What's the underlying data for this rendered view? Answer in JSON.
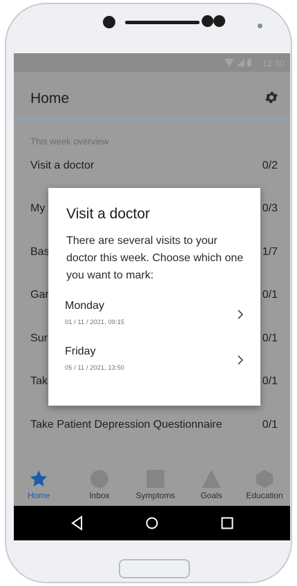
{
  "statusbar": {
    "time": "12:30",
    "icons": [
      "wifi-icon",
      "signal-icon",
      "battery-icon"
    ]
  },
  "appbar": {
    "title": "Home",
    "settings_icon": "gear-icon"
  },
  "overview": {
    "section_label": "This week overview",
    "rows": [
      {
        "label": "Visit a doctor",
        "count": "0/2"
      },
      {
        "label": "My",
        "count": "0/3"
      },
      {
        "label": "Bas",
        "count": "1/7"
      },
      {
        "label": "Gar",
        "count": "0/1"
      },
      {
        "label": "Sur",
        "count": "0/1"
      },
      {
        "label": "Tak",
        "count": "0/1"
      },
      {
        "label": "Take Patient Depression Questionnaire",
        "count": "0/1"
      }
    ]
  },
  "dialog": {
    "title": "Visit a doctor",
    "message": "There are several visits to your doctor this week. Choose which one you want to mark:",
    "choices": [
      {
        "day": "Monday",
        "datetime": "01 / 11 / 2021, 09:15"
      },
      {
        "day": "Friday",
        "datetime": "05 / 11 / 2021, 13:50"
      }
    ]
  },
  "bottom_nav": {
    "items": [
      {
        "label": "Home",
        "icon": "star-icon",
        "active": true
      },
      {
        "label": "Inbox",
        "icon": "circle-icon",
        "active": false
      },
      {
        "label": "Symptoms",
        "icon": "square-icon",
        "active": false
      },
      {
        "label": "Goals",
        "icon": "triangle-icon",
        "active": false
      },
      {
        "label": "Education",
        "icon": "hexagon-icon",
        "active": false
      }
    ]
  },
  "system_nav": [
    "back-icon",
    "home-icon",
    "recents-icon"
  ],
  "colors": {
    "accent": "#1a5ea8",
    "scrim": "#9c9c9c",
    "dialog_bg": "#ffffff"
  }
}
